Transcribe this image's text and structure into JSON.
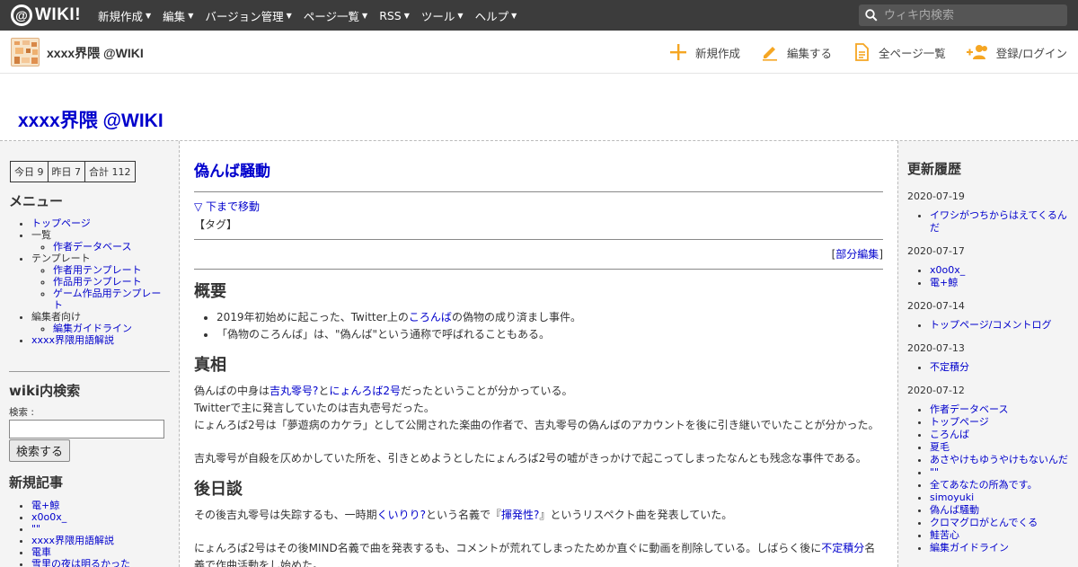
{
  "topbar": {
    "logo": "WIKI!",
    "logo_at": "@",
    "nav": [
      "新規作成",
      "編集",
      "バージョン管理",
      "ページ一覧",
      "RSS",
      "ツール",
      "ヘルプ"
    ],
    "search_placeholder": "ウィキ内検索"
  },
  "subbar": {
    "title": "xxxx界隈 @WIKI",
    "actions": [
      "新規作成",
      "編集する",
      "全ページ一覧",
      "登録/ログイン"
    ]
  },
  "site_title": "xxxx界隈 @WIKI",
  "left": {
    "counter": [
      "今日 9",
      "昨日 7",
      "合計 112"
    ],
    "menu_heading": "メニュー",
    "menu": {
      "top": "トップページ",
      "list": "一覧",
      "author_db": "作者データベース",
      "template": "テンプレート",
      "tpl_author": "作者用テンプレート",
      "tpl_work": "作品用テンプレート",
      "tpl_game": "ゲーム作品用テンプレート",
      "editors": "編集者向け",
      "guideline": "編集ガイドライン",
      "glossary": "xxxx界隈用語解説"
    },
    "search_heading": "wiki内検索",
    "search_label": "検索 :",
    "search_button": "検索する",
    "new_heading": "新規記事",
    "new_items": [
      "電+鯨",
      "x0o0x_",
      "\"\"",
      "xxxx界隈用語解説",
      "電車",
      "雪里の夜は明るかった"
    ]
  },
  "main": {
    "title": "偽んば騒動",
    "to_bottom": "▽ 下まで移動",
    "tag": "【タグ】",
    "partial_open": "[",
    "partial_edit": "部分編集",
    "partial_close": "]",
    "h_overview": "概要",
    "ov1_a": "2019年初始めに起こった、Twitter上の",
    "ov1_link": "ころんば",
    "ov1_b": "の偽物の成り済まし事件。",
    "ov2": "「偽物のころんば」は、\"偽んば\"という通称で呼ばれることもある。",
    "h_truth": "真相",
    "t1_a": "偽んばの中身は",
    "t1_link1": "吉丸零号?",
    "t1_b": "と",
    "t1_link2": "にょんろば2号",
    "t1_c": "だったということが分かっている。",
    "t2": "Twitterで主に発言していたのは吉丸壱号だった。",
    "t3": "にょんろば2号は「夢遊病のカケラ」として公開された楽曲の作者で、吉丸零号の偽んばのアカウントを後に引き継いでいたことが分かった。",
    "t4": "吉丸零号が自殺を仄めかしていた所を、引きとめようとしたにょんろば2号の嘘がきっかけで起こってしまったなんとも残念な事件である。",
    "h_after": "後日談",
    "a1_a": "その後吉丸零号は失踪するも、一時期",
    "a1_link1": "くいりり?",
    "a1_b": "という名義で『",
    "a1_link2": "揮発性?",
    "a1_c": "』というリスペクト曲を発表していた。",
    "a2_a": "にょんろば2号はその後MIND名義で曲を発表するも、コメントが荒れてしまったためか直ぐに動画を削除している。しばらく後に",
    "a2_link": "不定積分",
    "a2_b": "名義で作曲活動をし始めた。"
  },
  "right": {
    "heading": "更新履歴",
    "groups": [
      {
        "date": "2020-07-19",
        "items": [
          "イワシがつちからはえてくるんだ"
        ]
      },
      {
        "date": "2020-07-17",
        "items": [
          "x0o0x_",
          "電+鯨"
        ]
      },
      {
        "date": "2020-07-14",
        "items": [
          "トップページ/コメントログ"
        ]
      },
      {
        "date": "2020-07-13",
        "items": [
          "不定積分"
        ]
      },
      {
        "date": "2020-07-12",
        "items": [
          "作者データベース",
          "トップページ",
          "ころんば",
          "夏毛",
          "あさやけもゆうやけもないんだ",
          "\"\"",
          "全てあなたの所為です。",
          "simoyuki",
          "偽んば騒動",
          "クロマグロがとんでくる",
          "鮭苦心",
          "編集ガイドライン"
        ]
      }
    ]
  },
  "colors": {
    "topbar": "#3c3c3c",
    "link": "#0000cc",
    "accent": "#f5a623",
    "sidebar_bg": "#f4f4f4"
  }
}
